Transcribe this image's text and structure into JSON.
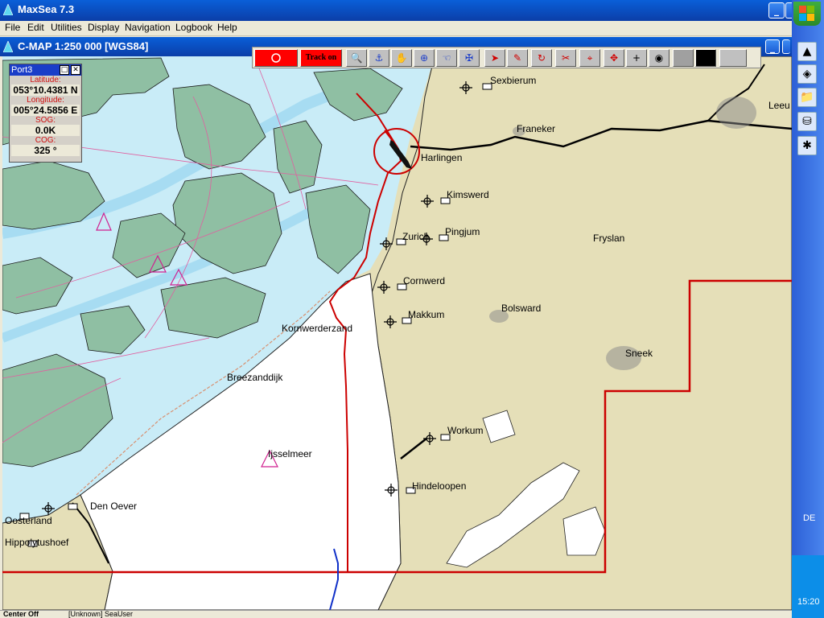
{
  "window": {
    "title": "MaxSea 7.3",
    "minimize": "_",
    "restore": "□"
  },
  "menu": [
    "File",
    "Edit",
    "Utilities",
    "Display",
    "Navigation",
    "Logbook",
    "Help"
  ],
  "document": {
    "title": "C-MAP  1:250 000 [WGS84]"
  },
  "toolbar": {
    "track_label": "Track on"
  },
  "info_panel": {
    "title": "Port3",
    "latitude_label": "Latitude:",
    "latitude": "053°10.4381 N",
    "longitude_label": "Longitude:",
    "longitude": "005°24.5856 E",
    "sog_label": "SOG:",
    "sog": "0.0K",
    "cog_label": "COG:",
    "cog": "325 °"
  },
  "places": {
    "sexbierum": "Sexbierum",
    "franeker": "Franeker",
    "leeuwarden": "Leeu",
    "harlingen": "Harlingen",
    "kimswerd": "Kimswerd",
    "zurich": "Zurich",
    "pingjum": "Pingjum",
    "fryslan": "Fryslan",
    "cornwerd": "Cornwerd",
    "makkum": "Makkum",
    "bolsward": "Bolsward",
    "kornwerderzand": "Kornwerderzand",
    "sneek": "Sneek",
    "breezanddijk": "Breezanddijk",
    "workum": "Workum",
    "ijsselmeer": "Ijsselmeer",
    "hindeloopen": "Hindeloopen",
    "den_oever": "Den Oever",
    "oosterland": "Oosterland",
    "hippolytushoef": "Hippolytushoef"
  },
  "status": {
    "left": "Center Off",
    "user": "[Unknown]  SeaUser"
  },
  "taskbar": {
    "language": "DE",
    "time": "15:20"
  },
  "colors": {
    "land": "#e5dfb8",
    "water": "#c9ecf7",
    "shoal": "#8fbfa3",
    "route": "#cc0000",
    "lake": "#ffffff"
  },
  "icons": [
    "maxsea-icon",
    "stop-icon",
    "magnifier-icon",
    "anchor-icon",
    "hand-icon",
    "crosshair-icon",
    "pan-icon",
    "compass-icon",
    "arrow-icon",
    "pencil-icon",
    "rotate-icon",
    "scissors-icon",
    "target-icon",
    "move-icon",
    "plus-icon",
    "waypoint-icon"
  ]
}
